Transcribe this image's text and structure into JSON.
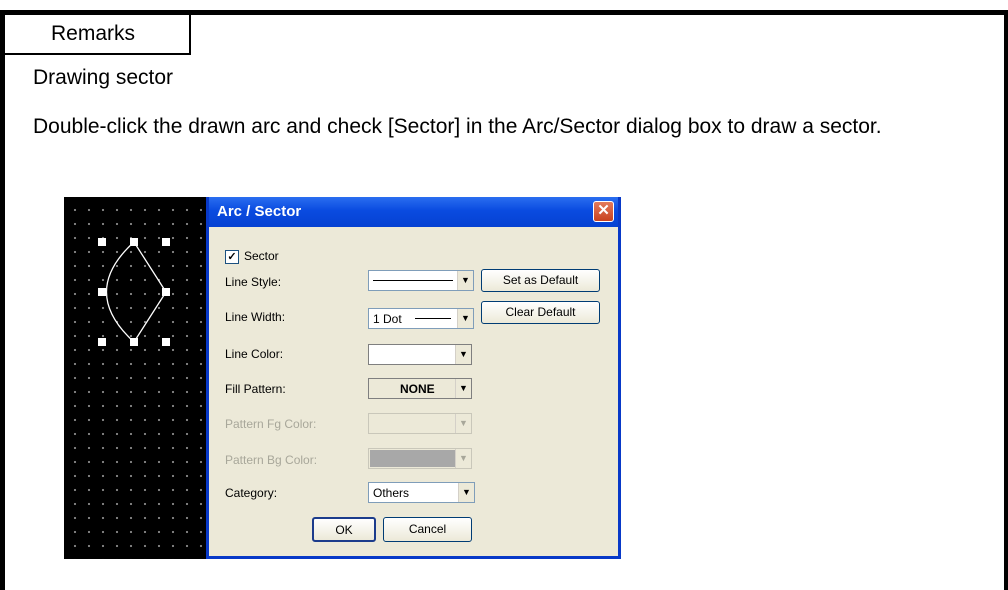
{
  "remarks_tab": "Remarks",
  "heading": "Drawing sector",
  "instruction": "Double-click the drawn arc and check [Sector] in the Arc/Sector dialog box to draw a sector.",
  "dialog": {
    "title": "Arc / Sector",
    "close_glyph": "✕",
    "sector_checkbox": {
      "label": "Sector",
      "checked": true,
      "glyph": "✓"
    },
    "fields": {
      "line_style": {
        "label": "Line Style:",
        "value": ""
      },
      "line_width": {
        "label": "Line Width:",
        "value": "1 Dot"
      },
      "line_color": {
        "label": "Line Color:",
        "value": "",
        "color": "#ffffff"
      },
      "fill_pattern": {
        "label": "Fill Pattern:",
        "value": "NONE"
      },
      "pattern_fg_color": {
        "label": "Pattern Fg Color:",
        "value": "",
        "enabled": false
      },
      "pattern_bg_color": {
        "label": "Pattern Bg Color:",
        "value": "",
        "enabled": false,
        "color": "#a8a8a8"
      },
      "category": {
        "label": "Category:",
        "value": "Others"
      }
    },
    "buttons": {
      "set_as_default": "Set as Default",
      "clear_default": "Clear Default",
      "ok": "OK",
      "cancel": "Cancel"
    },
    "dropdown_glyph": "▼"
  },
  "colors": {
    "titlebar": "#0a4be0",
    "dialog_bg": "#ece9d8",
    "canvas_bg": "#000000",
    "close": "#c8411f"
  }
}
